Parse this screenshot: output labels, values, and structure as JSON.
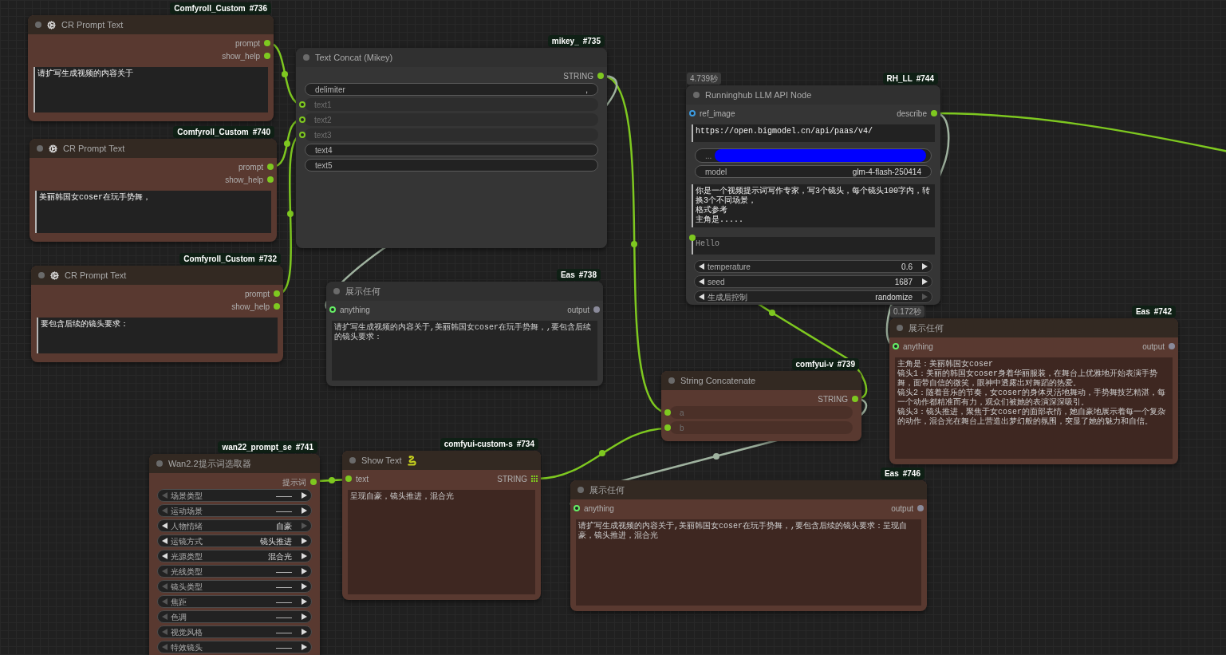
{
  "nodes": [
    {
      "kind": "prompt_text",
      "badge": {
        "source": "Comfyroll_Custom",
        "id": "#736"
      },
      "title": "CR Prompt Text",
      "color": "#593930",
      "title_bar": {
        "color": "#332922"
      },
      "outputs": [
        {
          "label": "prompt",
          "color": "#7ec820",
          "is_list": false
        },
        {
          "label": "show_help",
          "color": "#7ec820",
          "is_list": false
        }
      ],
      "widgets": [
        {
          "kind": "textarea",
          "value": "请扩写生成视频的内容关于",
          "linked": false
        }
      ]
    },
    {
      "kind": "prompt_text",
      "badge": {
        "source": "Comfyroll_Custom",
        "id": "#740"
      },
      "title": "CR Prompt Text",
      "color": "#593930",
      "title_bar": {
        "color": "#332922"
      },
      "outputs": [
        {
          "label": "prompt",
          "color": "#7ec820",
          "is_list": false
        },
        {
          "label": "show_help",
          "color": "#7ec820",
          "is_list": false
        }
      ],
      "widgets": [
        {
          "kind": "textarea",
          "value": "美丽韩国女coser在玩手势舞，",
          "linked": false
        }
      ]
    },
    {
      "kind": "prompt_text",
      "badge": {
        "source": "Comfyroll_Custom",
        "id": "#732"
      },
      "title": "CR Prompt Text",
      "color": "#593930",
      "title_bar": {
        "color": "#332922"
      },
      "outputs": [
        {
          "label": "prompt",
          "color": "#7ec820",
          "is_list": false
        },
        {
          "label": "show_help",
          "color": "#7ec820",
          "is_list": false
        }
      ],
      "widgets": [
        {
          "kind": "textarea",
          "value": "要包含后续的镜头要求：",
          "linked": false
        }
      ]
    },
    {
      "kind": "text_concat",
      "badge": {
        "source": "mikey_",
        "id": "#735"
      },
      "title": "Text Concat (Mikey)",
      "color": "#353535",
      "title_bar": {
        "color": "#303030"
      },
      "outputs": [
        {
          "label": "STRING",
          "color": "#7ec820",
          "is_list": false
        }
      ],
      "widgets": [
        {
          "kind": "text",
          "label": "delimiter",
          "value": ","
        },
        {
          "kind": "linked_input",
          "label": "text1",
          "color": "#7ec820",
          "hollow": true
        },
        {
          "kind": "linked_input",
          "label": "text2",
          "color": "#7ec820",
          "hollow": true
        },
        {
          "kind": "linked_input",
          "label": "text3",
          "color": "#7ec820",
          "hollow": true
        },
        {
          "kind": "text",
          "label": "text4"
        },
        {
          "kind": "text",
          "label": "text5"
        }
      ]
    },
    {
      "kind": "display_any",
      "badge": {
        "source": "Eas",
        "id": "#738"
      },
      "title": "展示任何",
      "color": "#353535",
      "title_bar": {
        "color": "#303030"
      },
      "inputs": [
        {
          "label": "anything",
          "color": "#66ee66",
          "hollow": true
        }
      ],
      "outputs": [
        {
          "label": "output",
          "color": "#8a8a9a",
          "is_list": false
        }
      ],
      "widgets": [
        {
          "kind": "display",
          "lines": [
            "请扩写生成视频的内容关于,美丽韩国女coser在玩手势舞，,要包含后续的镜头要求："
          ]
        }
      ]
    },
    {
      "kind": "llm_api",
      "timing": "4.739秒",
      "badge": {
        "source": "RH_LL",
        "id": "#744"
      },
      "title": "Runninghub LLM API Node",
      "color": "#353535",
      "title_bar": {
        "color": "#303030"
      },
      "inputs": [
        {
          "label": "ref_image",
          "color": "#3d9be0",
          "hollow": true
        }
      ],
      "outputs": [
        {
          "label": "describe",
          "color": "#7ec820",
          "is_list": false
        }
      ],
      "widgets": [
        {
          "kind": "textarea",
          "value": "https://open.bigmodel.cn/api/paas/v4/",
          "linked": false
        },
        {
          "kind": "redacted",
          "label": "..."
        },
        {
          "kind": "text",
          "label": "model",
          "value": "glm-4-flash-250414"
        },
        {
          "kind": "textarea",
          "lines": [
            "你是一个视频提示词写作专家，写3个镜头，每个镜头100字内，转换3个不同场景，",
            "格式参考",
            "主角是....."
          ],
          "linked": false
        },
        {
          "kind": "textarea",
          "value": "Hello",
          "linked": true,
          "color": "#7ec820"
        },
        {
          "kind": "number",
          "label": "temperature",
          "value": "0.6",
          "left_enabled": true,
          "right_enabled": true
        },
        {
          "kind": "number",
          "label": "seed",
          "value": "1687",
          "left_enabled": true,
          "right_enabled": true
        },
        {
          "kind": "combo",
          "label": "生成后控制",
          "value": "randomize",
          "left_enabled": true,
          "right_enabled": false
        }
      ]
    },
    {
      "kind": "display_any",
      "timing": "0.172秒",
      "badge": {
        "source": "Eas",
        "id": "#742"
      },
      "title": "展示任何",
      "color": "#593930",
      "title_bar": {
        "color": "#332922"
      },
      "inputs": [
        {
          "label": "anything",
          "color": "#66ee66",
          "hollow": true
        }
      ],
      "outputs": [
        {
          "label": "output",
          "color": "#8a8a9a",
          "is_list": false
        }
      ],
      "widgets": [
        {
          "kind": "display",
          "lines": [
            "主角是：美丽韩国女coser",
            "镜头1：美丽的韩国女coser身着华丽服装，在舞台上优雅地开始表演手势舞，面带自信的微笑，眼神中透露出对舞蹈的热爱。",
            "镜头2：随着音乐的节奏，女coser的身体灵活地舞动，手势舞技艺精湛，每一个动作都精准而有力，观众们被她的表演深深吸引。",
            "镜头3：镜头推进，聚焦于女coser的面部表情，她自豪地展示着每一个复杂的动作，混合光在舞台上营造出梦幻般的氛围，突显了她的魅力和自信。"
          ]
        }
      ]
    },
    {
      "kind": "string_concat",
      "badge": {
        "source": "comfyui-v",
        "id": "#739"
      },
      "title": "String Concatenate",
      "color": "#593930",
      "title_bar": {
        "color": "#332922"
      },
      "outputs": [
        {
          "label": "STRING",
          "color": "#7ec820",
          "is_list": false
        }
      ],
      "widgets": [
        {
          "kind": "linked_input",
          "label": "a",
          "color": "#7ec820",
          "hollow": false
        },
        {
          "kind": "linked_input",
          "label": "b",
          "color": "#7ec820",
          "hollow": false
        }
      ]
    },
    {
      "kind": "prompt_selector",
      "badge": {
        "source": "wan22_prompt_se",
        "id": "#741"
      },
      "title": "Wan2.2提示词选取器",
      "color": "#593930",
      "title_bar": {
        "color": "#332922"
      },
      "outputs": [
        {
          "label": "提示词",
          "color": "#7ec820",
          "is_list": false
        }
      ],
      "widgets": [
        {
          "kind": "combo",
          "label": "场景类型",
          "value": "——",
          "left_enabled": false,
          "right_enabled": true
        },
        {
          "kind": "combo",
          "label": "运动场景",
          "value": "——",
          "left_enabled": false,
          "right_enabled": true
        },
        {
          "kind": "combo",
          "label": "人物情绪",
          "value": "自豪",
          "left_enabled": true,
          "right_enabled": false
        },
        {
          "kind": "combo",
          "label": "运镜方式",
          "value": "镜头推进",
          "left_enabled": true,
          "right_enabled": true
        },
        {
          "kind": "combo",
          "label": "光源类型",
          "value": "混合光",
          "left_enabled": true,
          "right_enabled": true
        },
        {
          "kind": "combo",
          "label": "光线类型",
          "value": "——",
          "left_enabled": false,
          "right_enabled": true
        },
        {
          "kind": "combo",
          "label": "镜头类型",
          "value": "——",
          "left_enabled": false,
          "right_enabled": true
        },
        {
          "kind": "combo",
          "label": "焦距",
          "value": "——",
          "left_enabled": false,
          "right_enabled": true
        },
        {
          "kind": "combo",
          "label": "色调",
          "value": "——",
          "left_enabled": false,
          "right_enabled": true
        },
        {
          "kind": "combo",
          "label": "视觉风格",
          "value": "——",
          "left_enabled": false,
          "right_enabled": true
        },
        {
          "kind": "combo",
          "label": "特效镜头",
          "value": "——",
          "left_enabled": false,
          "right_enabled": true
        }
      ]
    },
    {
      "kind": "show_text",
      "badge": {
        "source": "comfyui-custom-s",
        "id": "#734"
      },
      "title": "Show Text",
      "color": "#593930",
      "title_bar": {
        "color": "#332922"
      },
      "inputs": [
        {
          "label": "text",
          "color": "#7ec820",
          "hollow": false
        }
      ],
      "outputs": [
        {
          "label": "STRING",
          "color": "#7ec820",
          "is_list": true
        }
      ],
      "widgets": [
        {
          "kind": "display",
          "lines": [
            "呈现自豪，镜头推进，混合光"
          ]
        }
      ]
    },
    {
      "kind": "display_any",
      "badge": {
        "source": "Eas",
        "id": "#746"
      },
      "title": "展示任何",
      "color": "#593930",
      "title_bar": {
        "color": "#332922"
      },
      "inputs": [
        {
          "label": "anything",
          "color": "#66ee66",
          "hollow": true
        }
      ],
      "outputs": [
        {
          "label": "output",
          "color": "#8a8a9a",
          "is_list": false
        }
      ],
      "widgets": [
        {
          "kind": "display",
          "lines": [
            "请扩写生成视频的内容关于,美丽韩国女coser在玩手势舞，,要包含后续的镜头要求：呈现自豪，镜头推进，混合光"
          ]
        }
      ]
    }
  ]
}
